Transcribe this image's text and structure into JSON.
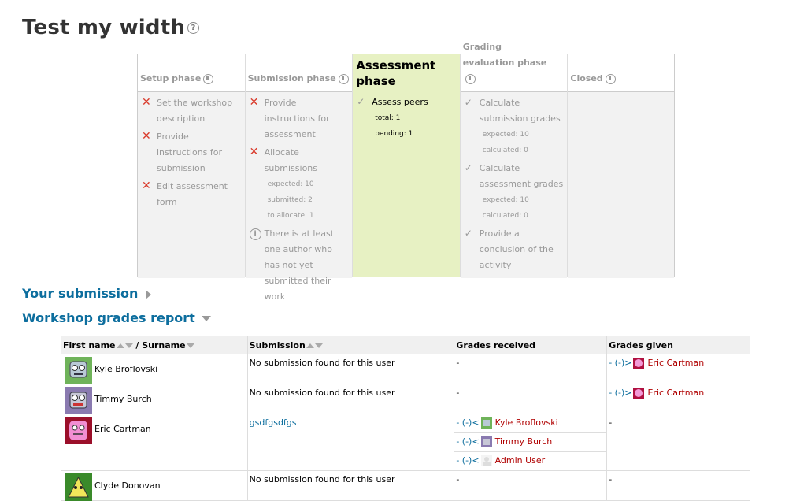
{
  "page": {
    "title": "Test my width"
  },
  "phases": [
    {
      "name": "Setup phase",
      "tasks": [
        {
          "icon": "fail",
          "label": "Set the workshop description"
        },
        {
          "icon": "fail",
          "label": "Provide instructions for submission"
        },
        {
          "icon": "fail",
          "label": "Edit assessment form"
        }
      ]
    },
    {
      "name": "Submission phase",
      "tasks": [
        {
          "icon": "fail",
          "label": "Provide instructions for assessment"
        },
        {
          "icon": "fail",
          "label": "Allocate submissions",
          "details": [
            "expected: 10",
            "submitted: 2",
            "to allocate: 1"
          ]
        },
        {
          "icon": "info",
          "label": "There is at least one author who has not yet submitted their work"
        }
      ]
    },
    {
      "name": "Assessment phase",
      "tasks": [
        {
          "icon": "todo",
          "label": "Assess peers",
          "details": [
            "total: 1",
            "pending: 1"
          ]
        }
      ]
    },
    {
      "name": "Grading evaluation phase",
      "tasks": [
        {
          "icon": "todo",
          "label": "Calculate submission grades",
          "details": [
            "expected: 10",
            "calculated: 0"
          ]
        },
        {
          "icon": "todo",
          "label": "Calculate assessment grades",
          "details": [
            "expected: 10",
            "calculated: 0"
          ]
        },
        {
          "icon": "todo",
          "label": "Provide a conclusion of the activity"
        }
      ]
    },
    {
      "name": "Closed",
      "tasks": []
    }
  ],
  "sections": {
    "your_submission": "Your submission",
    "grades_report": "Workshop grades report"
  },
  "table": {
    "headers": {
      "first_name": "First name",
      "sep": " / ",
      "surname": "Surname",
      "submission": "Submission",
      "grades_received": "Grades received",
      "grades_given": "Grades given"
    },
    "rows": [
      {
        "name": "Kyle Broflovski",
        "avatar": "robot-blue",
        "submission": "No submission found for this user",
        "received": "-",
        "given_prefix": "- (-)>",
        "given_user": "Eric Cartman"
      },
      {
        "name": "Timmy Burch",
        "avatar": "robot-purple",
        "submission": "No submission found for this user",
        "received": "-",
        "given_prefix": "- (-)>",
        "given_user": "Eric Cartman"
      },
      {
        "name": "Eric Cartman",
        "avatar": "pink-monster",
        "submission": "gsdfgsdfgs",
        "received_list": [
          {
            "prefix": "- (-)<",
            "user": "Kyle Broflovski"
          },
          {
            "prefix": "- (-)<",
            "user": "Timmy Burch"
          },
          {
            "prefix": "- (-)<",
            "user": "Admin User"
          }
        ],
        "given": "-"
      },
      {
        "name": "Clyde Donovan",
        "avatar": "yellow-triangle",
        "submission": "No submission found for this user",
        "received": "-",
        "given": "-"
      }
    ]
  },
  "colors": {
    "link": "#0d6e9e",
    "active_phase": "#e7f1c3",
    "fail": "#d93a2b",
    "user_link": "#b00000"
  }
}
